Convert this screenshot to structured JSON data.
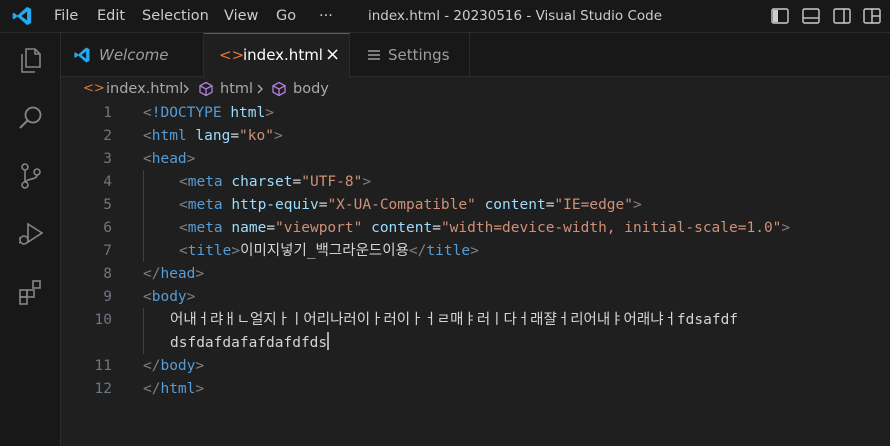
{
  "window": {
    "title": "index.html - 20230516 - Visual Studio Code"
  },
  "menu": [
    "File",
    "Edit",
    "Selection",
    "View",
    "Go",
    "···"
  ],
  "tabs": [
    {
      "label": "Welcome",
      "icon": "vscode-icon"
    },
    {
      "label": "index.html",
      "icon": "html-icon",
      "close": "×"
    },
    {
      "label": "Settings",
      "icon": "settings-icon"
    }
  ],
  "breadcrumb": {
    "file": "index.html",
    "html": "html",
    "body": "body"
  },
  "editor": {
    "line_numbers": [
      "1",
      "2",
      "3",
      "4",
      "5",
      "6",
      "7",
      "8",
      "9",
      "10",
      "",
      "11",
      "12"
    ],
    "lines": [
      {
        "tokens": [
          {
            "k": "b",
            "t": "<"
          },
          {
            "k": "t",
            "t": "!DOCTYPE"
          },
          {
            "k": "x",
            "t": " "
          },
          {
            "k": "a",
            "t": "html"
          },
          {
            "k": "b",
            "t": ">"
          }
        ]
      },
      {
        "tokens": [
          {
            "k": "b",
            "t": "<"
          },
          {
            "k": "t",
            "t": "html"
          },
          {
            "k": "x",
            "t": " "
          },
          {
            "k": "a",
            "t": "lang"
          },
          {
            "k": "x",
            "t": "="
          },
          {
            "k": "s",
            "t": "\"ko\""
          },
          {
            "k": "b",
            "t": ">"
          }
        ]
      },
      {
        "tokens": [
          {
            "k": "b",
            "t": "<"
          },
          {
            "k": "t",
            "t": "head"
          },
          {
            "k": "b",
            "t": ">"
          }
        ]
      },
      {
        "indent": 1,
        "tokens": [
          {
            "k": "b",
            "t": "<"
          },
          {
            "k": "t",
            "t": "meta"
          },
          {
            "k": "x",
            "t": " "
          },
          {
            "k": "a",
            "t": "charset"
          },
          {
            "k": "x",
            "t": "="
          },
          {
            "k": "s",
            "t": "\"UTF-8\""
          },
          {
            "k": "b",
            "t": ">"
          }
        ]
      },
      {
        "indent": 1,
        "tokens": [
          {
            "k": "b",
            "t": "<"
          },
          {
            "k": "t",
            "t": "meta"
          },
          {
            "k": "x",
            "t": " "
          },
          {
            "k": "a",
            "t": "http-equiv"
          },
          {
            "k": "x",
            "t": "="
          },
          {
            "k": "s",
            "t": "\"X-UA-Compatible\""
          },
          {
            "k": "x",
            "t": " "
          },
          {
            "k": "a",
            "t": "content"
          },
          {
            "k": "x",
            "t": "="
          },
          {
            "k": "s",
            "t": "\"IE=edge\""
          },
          {
            "k": "b",
            "t": ">"
          }
        ]
      },
      {
        "indent": 1,
        "tokens": [
          {
            "k": "b",
            "t": "<"
          },
          {
            "k": "t",
            "t": "meta"
          },
          {
            "k": "x",
            "t": " "
          },
          {
            "k": "a",
            "t": "name"
          },
          {
            "k": "x",
            "t": "="
          },
          {
            "k": "s",
            "t": "\"viewport\""
          },
          {
            "k": "x",
            "t": " "
          },
          {
            "k": "a",
            "t": "content"
          },
          {
            "k": "x",
            "t": "="
          },
          {
            "k": "s",
            "t": "\"width=device-width, initial-scale=1.0\""
          },
          {
            "k": "b",
            "t": ">"
          }
        ]
      },
      {
        "indent": 1,
        "tokens": [
          {
            "k": "b",
            "t": "<"
          },
          {
            "k": "t",
            "t": "title"
          },
          {
            "k": "b",
            "t": ">"
          },
          {
            "k": "x",
            "t": "이미지넣기_백그라운드이용"
          },
          {
            "k": "b",
            "t": "</"
          },
          {
            "k": "t",
            "t": "title"
          },
          {
            "k": "b",
            "t": ">"
          }
        ]
      },
      {
        "tokens": [
          {
            "k": "b",
            "t": "</"
          },
          {
            "k": "t",
            "t": "head"
          },
          {
            "k": "b",
            "t": ">"
          }
        ]
      },
      {
        "tokens": [
          {
            "k": "b",
            "t": "<"
          },
          {
            "k": "t",
            "t": "body"
          },
          {
            "k": "b",
            "t": ">"
          }
        ]
      },
      {
        "indent": 0.75,
        "tokens": [
          {
            "k": "x",
            "t": "어내ㅓ랴ㅐㄴ얼지ㅏㅣ어리나러이ㅏ러이ㅏㅓㄹ매ㅑ러ㅣ다ㅓ래쟐ㅓ리어내ㅑ어래냐ㅓfdsafdf"
          }
        ]
      },
      {
        "indent": 0.75,
        "cursor": true,
        "tokens": [
          {
            "k": "x",
            "t": "dsfdafdafafdafdfds"
          }
        ]
      },
      {
        "tokens": [
          {
            "k": "b",
            "t": "</"
          },
          {
            "k": "t",
            "t": "body"
          },
          {
            "k": "b",
            "t": ">"
          }
        ]
      },
      {
        "tokens": [
          {
            "k": "b",
            "t": "</"
          },
          {
            "k": "t",
            "t": "html"
          },
          {
            "k": "b",
            "t": ">"
          }
        ]
      }
    ]
  },
  "colors": {
    "background": "#1f1f1f",
    "bar": "#181818",
    "accent": "#0078d4",
    "vscode_blue": "#23a9f2",
    "tag": "#569cd6",
    "attribute": "#9cdcfe",
    "string": "#ce9178",
    "bracket": "#808080",
    "text": "#d4d4d4",
    "html_icon": "#e37933"
  }
}
